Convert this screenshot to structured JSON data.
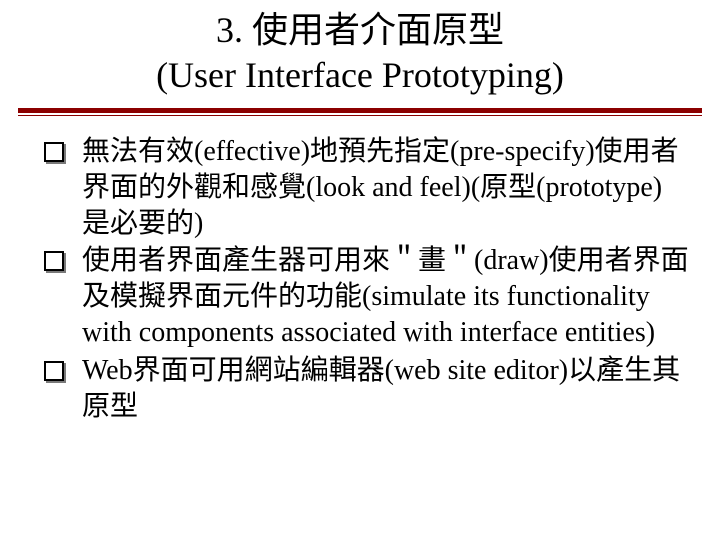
{
  "title": {
    "line1": "3. 使用者介面原型",
    "line2": "(User Interface Prototyping)"
  },
  "bullets": [
    "無法有效(effective)地預先指定(pre-specify)使用者界面的外觀和感覺(look and feel)(原型(prototype)是必要的)",
    "使用者界面產生器可用來＂畫＂(draw)使用者界面及模擬界面元件的功能(simulate its functionality with components associated with interface entities)",
    "Web界面可用網站編輯器(web site editor)以產生其原型"
  ]
}
